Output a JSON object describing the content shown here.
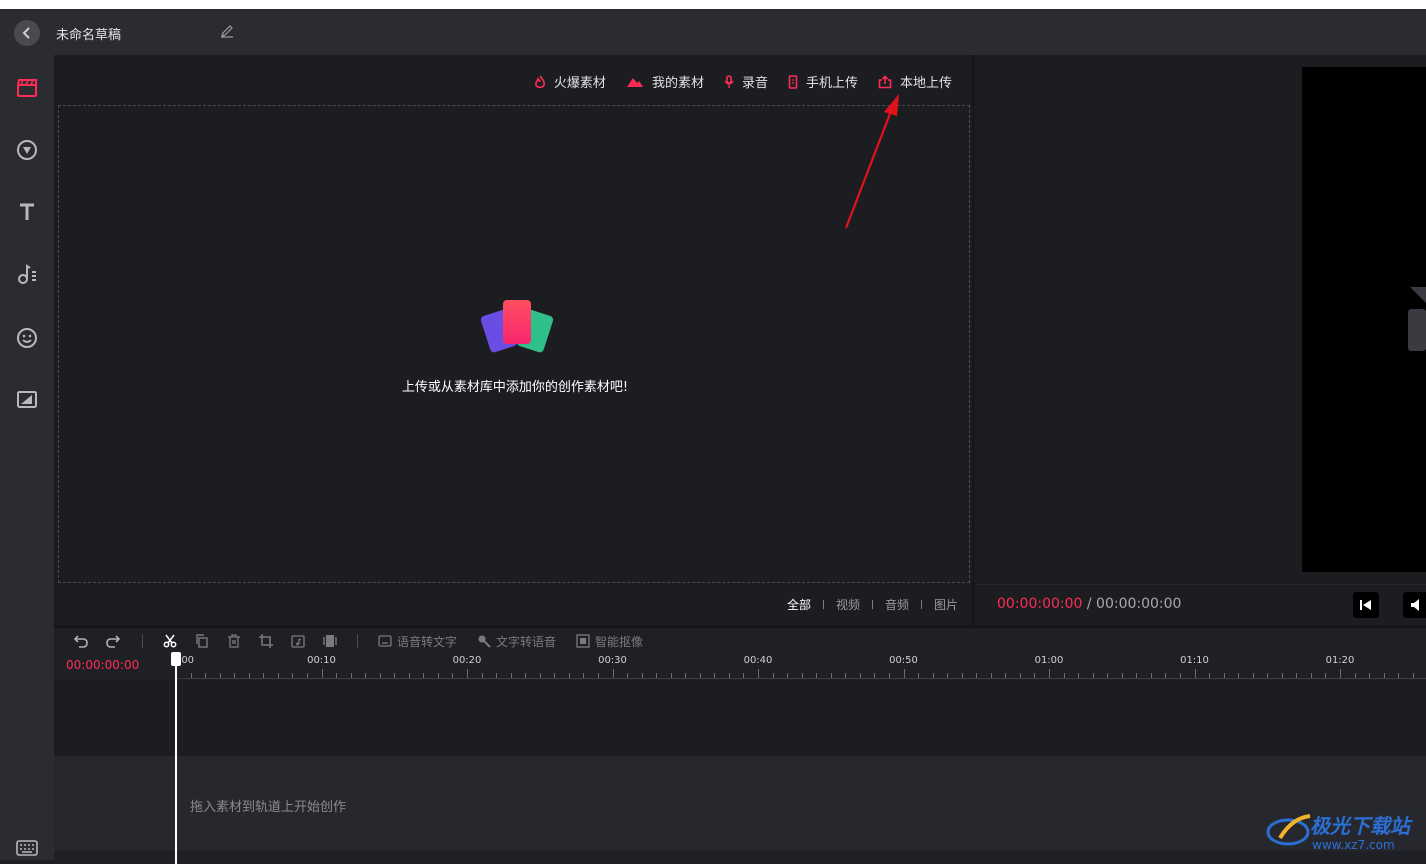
{
  "titlebar": {
    "title": "未命名草稿"
  },
  "library": {
    "tabs": [
      {
        "label": "火爆素材",
        "icon": "flame-icon"
      },
      {
        "label": "我的素材",
        "icon": "mountain-icon"
      },
      {
        "label": "录音",
        "icon": "microphone-icon"
      },
      {
        "label": "手机上传",
        "icon": "phone-icon"
      },
      {
        "label": "本地上传",
        "icon": "upload-icon"
      }
    ],
    "empty_text": "上传或从素材库中添加你的创作素材吧!",
    "filters": [
      "全部",
      "视频",
      "音频",
      "图片"
    ],
    "active_filter": "全部"
  },
  "preview": {
    "current_time": "00:00:00:00",
    "separator": " / ",
    "total_time": "00:00:00:00"
  },
  "timeline": {
    "time": "00:00:00:00",
    "tools": [
      {
        "label": "语音转文字",
        "icon": "subtitle-icon"
      },
      {
        "label": "文字转语音",
        "icon": "tts-icon"
      },
      {
        "label": "智能抠像",
        "icon": "cutout-icon"
      }
    ],
    "ruler_labels": [
      ":00",
      "00:10",
      "00:20",
      "00:30",
      "00:40",
      "00:50",
      "01:00",
      "01:10",
      "01:20"
    ],
    "drop_hint": "拖入素材到轨道上开始创作"
  },
  "watermark": {
    "title": "极光下载站",
    "url": "www.xz7.com"
  },
  "colors": {
    "accent": "#fe2c55",
    "background": "#1c1d21",
    "sidebar": "#2b2c31"
  }
}
